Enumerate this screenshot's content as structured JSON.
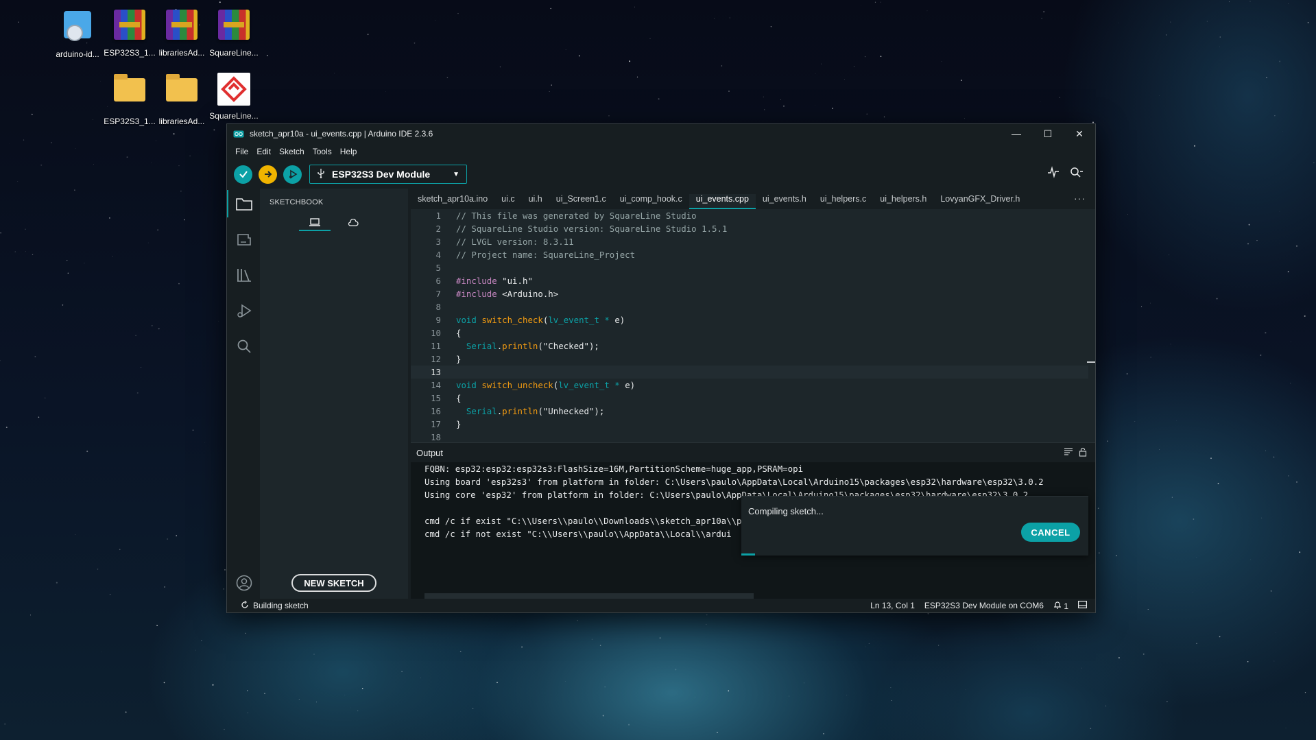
{
  "desktop": {
    "icons": [
      {
        "label": "arduino-id..."
      },
      {
        "label": "ESP32S3_1..."
      },
      {
        "label": "librariesAd..."
      },
      {
        "label": "SquareLine..."
      },
      {
        "label": "ESP32S3_1..."
      },
      {
        "label": "librariesAd..."
      },
      {
        "label": "SquareLine..."
      }
    ]
  },
  "window": {
    "title": "sketch_apr10a - ui_events.cpp | Arduino IDE 2.3.6",
    "controls": {
      "minimize": "—",
      "maximize": "☐",
      "close": "✕"
    }
  },
  "menu": [
    "File",
    "Edit",
    "Sketch",
    "Tools",
    "Help"
  ],
  "toolbar": {
    "board": "ESP32S3 Dev Module"
  },
  "sidebar": {
    "title": "SKETCHBOOK",
    "new_sketch": "NEW SKETCH"
  },
  "tabs": [
    {
      "label": "sketch_apr10a.ino",
      "active": false
    },
    {
      "label": "ui.c",
      "active": false
    },
    {
      "label": "ui.h",
      "active": false
    },
    {
      "label": "ui_Screen1.c",
      "active": false
    },
    {
      "label": "ui_comp_hook.c",
      "active": false
    },
    {
      "label": "ui_events.cpp",
      "active": true
    },
    {
      "label": "ui_events.h",
      "active": false
    },
    {
      "label": "ui_helpers.c",
      "active": false
    },
    {
      "label": "ui_helpers.h",
      "active": false
    },
    {
      "label": "LovyanGFX_Driver.h",
      "active": false
    }
  ],
  "code": {
    "current_line": 13,
    "lines": [
      [
        [
          "c-comment",
          "// This file was generated by SquareLine Studio"
        ]
      ],
      [
        [
          "c-comment",
          "// SquareLine Studio version: SquareLine Studio 1.5.1"
        ]
      ],
      [
        [
          "c-comment",
          "// LVGL version: 8.3.11"
        ]
      ],
      [
        [
          "c-comment",
          "// Project name: SquareLine_Project"
        ]
      ],
      [],
      [
        [
          "c-pre",
          "#include "
        ],
        [
          "c-str",
          "\"ui.h\""
        ]
      ],
      [
        [
          "c-pre",
          "#include "
        ],
        [
          "c-str",
          "<Arduino.h>"
        ]
      ],
      [],
      [
        [
          "c-kw",
          "void "
        ],
        [
          "c-fn",
          "switch_check"
        ],
        [
          "c-txt",
          "("
        ],
        [
          "c-type",
          "lv_event_t"
        ],
        [
          "c-kw",
          " * "
        ],
        [
          "c-txt",
          "e)"
        ]
      ],
      [
        [
          "c-txt",
          "{"
        ]
      ],
      [
        [
          "c-txt",
          "  "
        ],
        [
          "c-kw",
          "Serial"
        ],
        [
          "c-txt",
          "."
        ],
        [
          "c-fn",
          "println"
        ],
        [
          "c-txt",
          "(\"Checked\");"
        ]
      ],
      [
        [
          "c-txt",
          "}"
        ]
      ],
      [],
      [
        [
          "c-kw",
          "void "
        ],
        [
          "c-fn",
          "switch_uncheck"
        ],
        [
          "c-txt",
          "("
        ],
        [
          "c-type",
          "lv_event_t"
        ],
        [
          "c-kw",
          " * "
        ],
        [
          "c-txt",
          "e)"
        ]
      ],
      [
        [
          "c-txt",
          "{"
        ]
      ],
      [
        [
          "c-txt",
          "  "
        ],
        [
          "c-kw",
          "Serial"
        ],
        [
          "c-txt",
          "."
        ],
        [
          "c-fn",
          "println"
        ],
        [
          "c-txt",
          "(\"Unhecked\");"
        ]
      ],
      [
        [
          "c-txt",
          "}"
        ]
      ],
      []
    ]
  },
  "output": {
    "title": "Output",
    "lines": [
      "FQBN: esp32:esp32:esp32s3:FlashSize=16M,PartitionScheme=huge_app,PSRAM=opi",
      "Using board 'esp32s3' from platform in folder: C:\\Users\\paulo\\AppData\\Local\\Arduino15\\packages\\esp32\\hardware\\esp32\\3.0.2",
      "Using core 'esp32' from platform in folder: C:\\Users\\paulo\\AppData\\Local\\Arduino15\\packages\\esp32\\hardware\\esp32\\3.0.2",
      "",
      "cmd /c if exist \"C:\\\\Users\\\\paulo\\\\Downloads\\\\sketch_apr10a\\\\partitions.csv\" COPY /y \"C:\\\\Users\\\\paulo\\\\Downloads\\\\sketch_apr10",
      "cmd /c if not exist \"C:\\\\Users\\\\paulo\\\\AppData\\\\Local\\\\ardui"
    ]
  },
  "notification": {
    "message": "Compiling sketch...",
    "cancel": "CANCEL"
  },
  "status": {
    "left": "Building sketch",
    "position": "Ln 13, Col 1",
    "board_port": "ESP32S3 Dev Module on COM6",
    "notifications": "1"
  },
  "colors": {
    "accent": "#0ca1a6",
    "verify": "#0ca1a6",
    "upload": "#f0b400"
  }
}
